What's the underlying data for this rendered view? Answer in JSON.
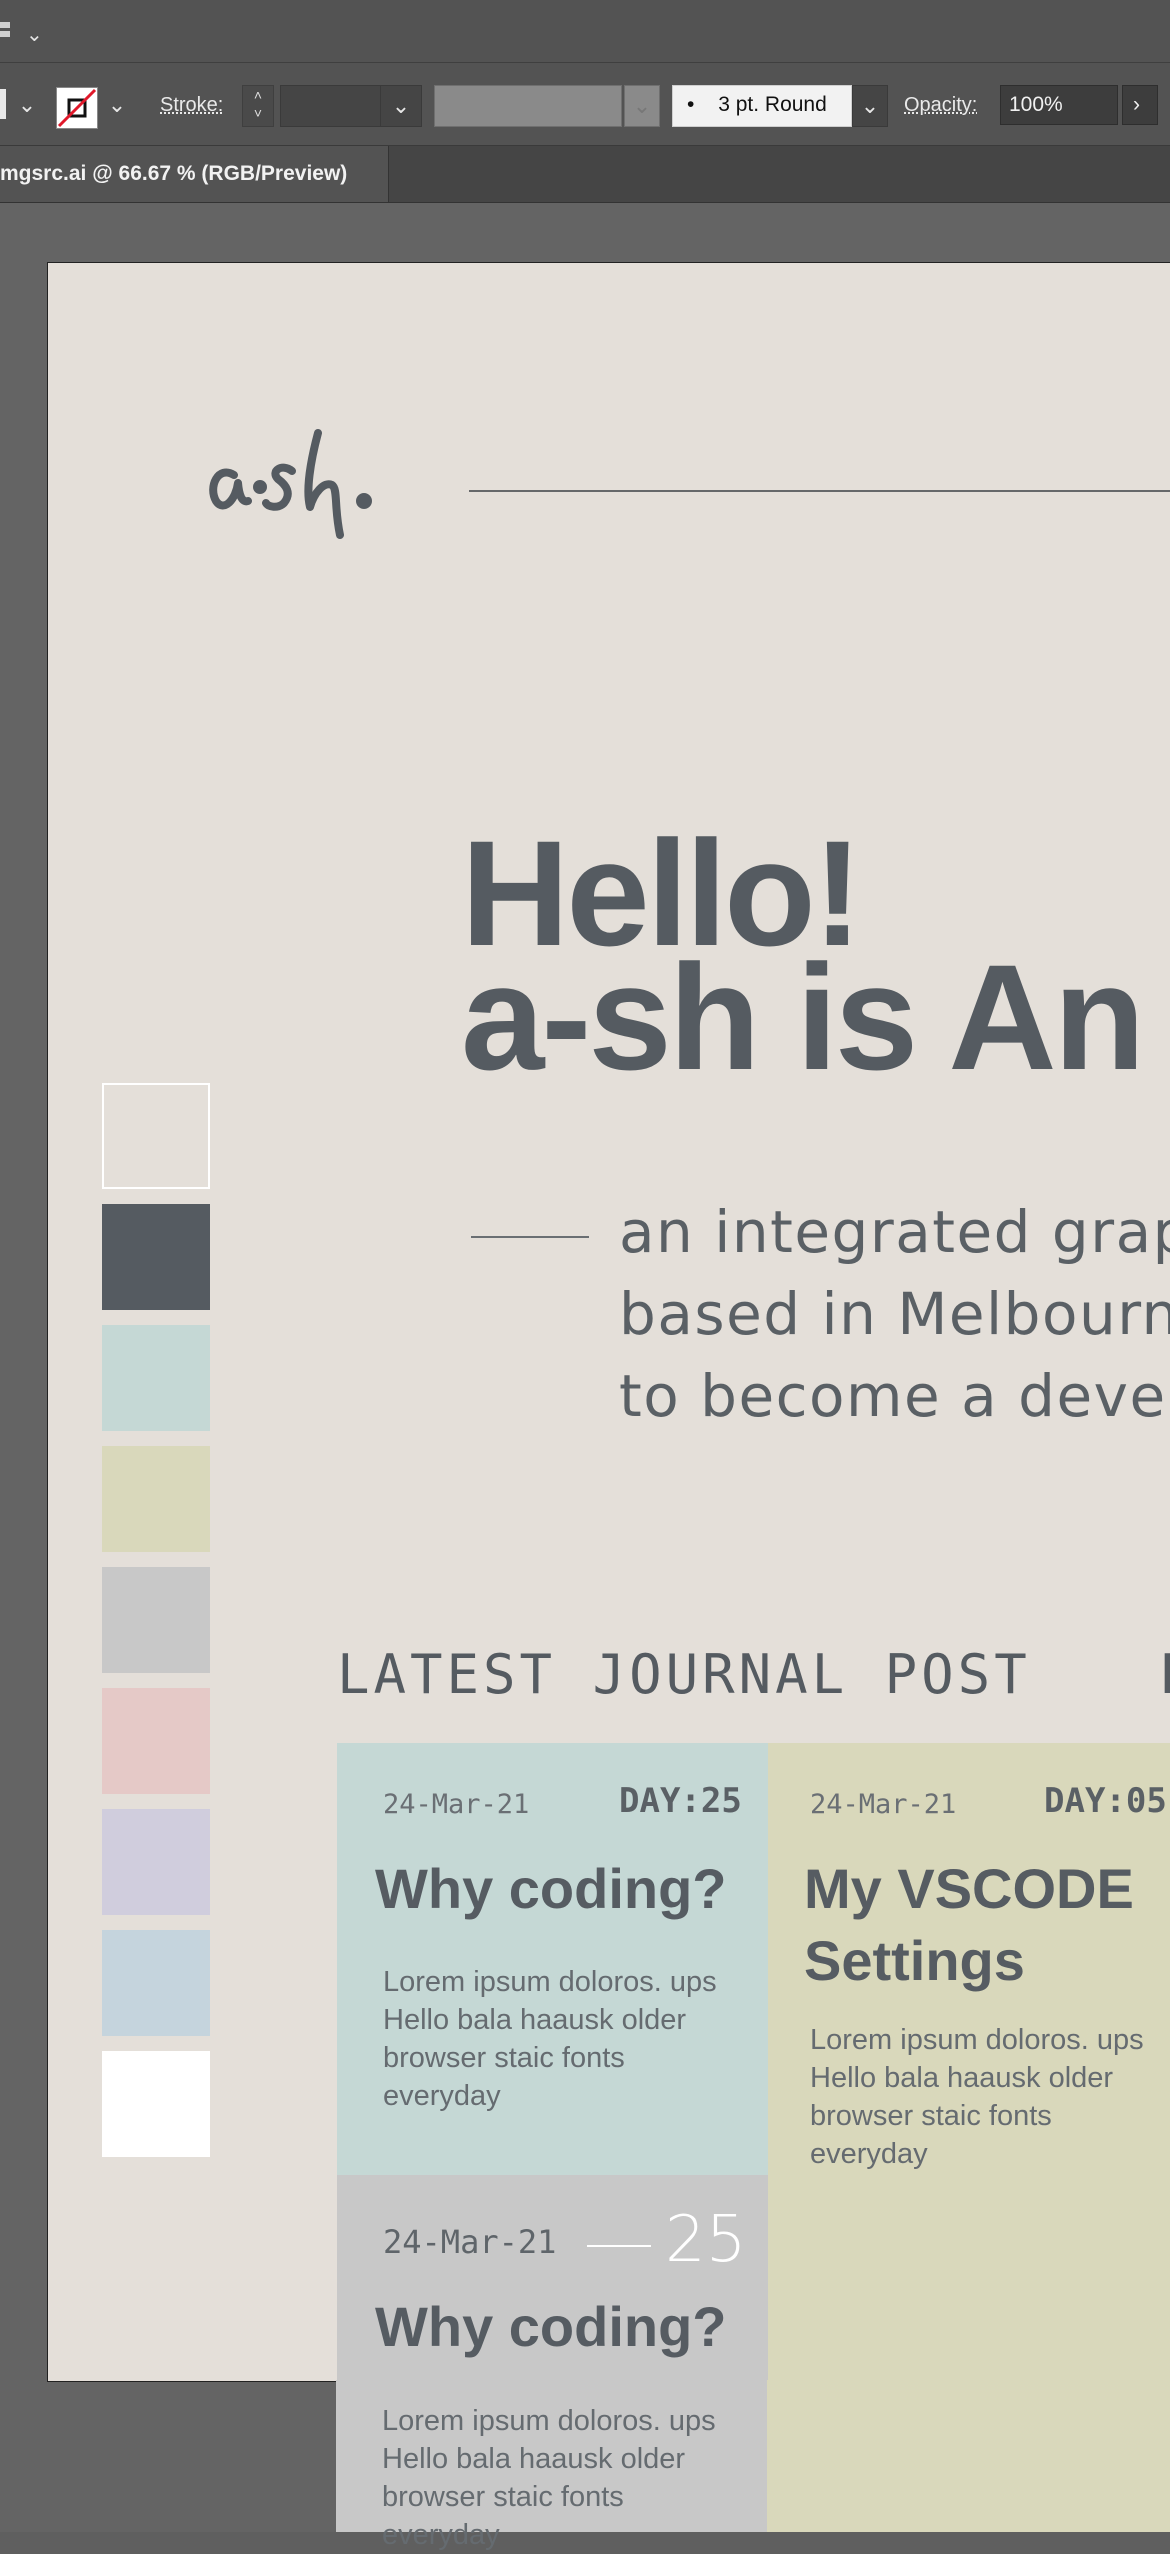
{
  "controlbar": {
    "stroke_label": "Stroke:",
    "stroke_weight": "",
    "brush_label": "3 pt. Round",
    "opacity_label": "Opacity:",
    "opacity_value": "100%"
  },
  "tab": {
    "doc_title": "mgsrc.ai @ 66.67 % (RGB/Preview)"
  },
  "artboard": {
    "hero_line1": "Hello!",
    "hero_line2": "a-sh is An",
    "intro_lines": [
      "an integrated grap",
      "based in Melbourn",
      "to become a deve"
    ],
    "section_title": "LATEST  JOURNAL  POST",
    "section_title_right": "L",
    "palette_colors": [
      "#e4dfd9",
      "#555b61",
      "#c5d8d5",
      "#d9d8bb",
      "#c8c8c8",
      "#e5c9c7",
      "#d0cddd",
      "#c5d4dd",
      "#ffffff"
    ],
    "cards": [
      {
        "date": "24-Mar-21",
        "day": "DAY:25",
        "title": "Why coding?",
        "body": [
          "Lorem ipsum doloros. ups",
          "Hello bala haausk older",
          "browser staic fonts",
          "everyday"
        ],
        "color": "#c5d8d5"
      },
      {
        "date": "24-Mar-21",
        "day": "DAY:05",
        "title": [
          "My VSCODE",
          "Settings"
        ],
        "body": [
          "Lorem ipsum doloros. ups",
          "Hello bala haausk older",
          "browser staic fonts",
          "everyday"
        ],
        "color": "#d9d8bb"
      },
      {
        "date": "24-Mar-21",
        "num": "25",
        "title": "Why coding?",
        "body": [
          "Lorem ipsum doloros. ups",
          "Hello bala haausk older",
          "browser staic fonts",
          "everyday"
        ],
        "color": "#c8c8c8"
      }
    ]
  }
}
